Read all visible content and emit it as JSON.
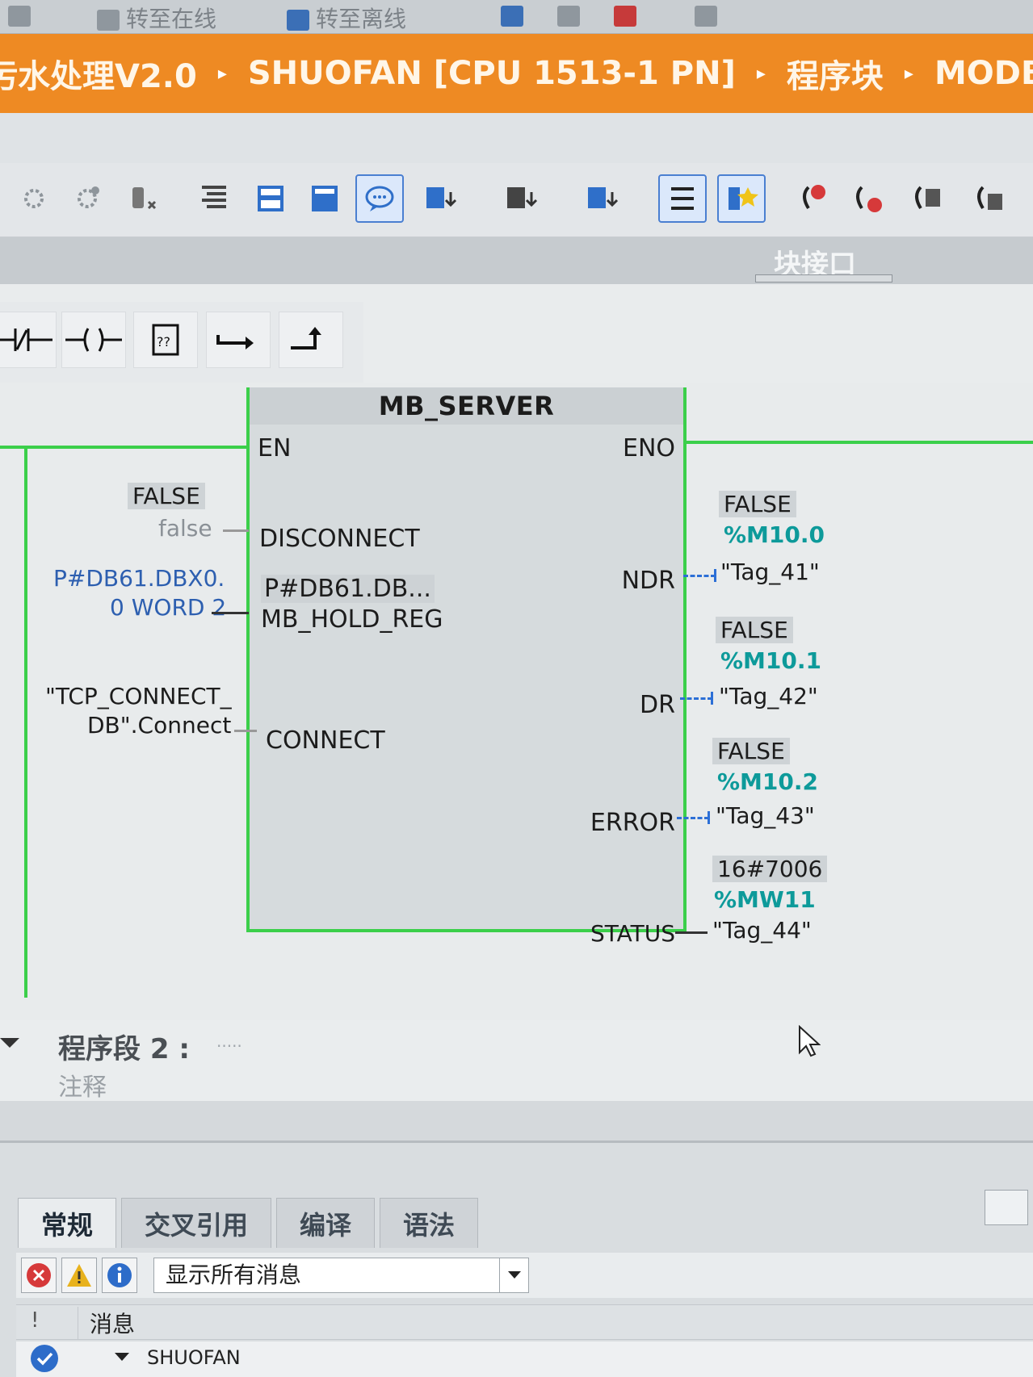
{
  "top_strip": {
    "item1": "转至在线",
    "item2": "转至离线"
  },
  "breadcrumb": {
    "items": [
      "污水处理V2.0",
      "SHUOFAN [CPU 1513-1 PN]",
      "程序块",
      "MODBUS"
    ],
    "separator": "▸",
    "color": "#ee8a23"
  },
  "toolbar": {
    "icons": [
      "compile-icon",
      "compile-all-icon",
      "download-icon",
      "indent-icon",
      "insert-network-icon",
      "delete-network-icon",
      "comment-icon",
      "input-icon",
      "output-icon",
      "inout-icon",
      "list-icon",
      "favorites-icon",
      "go-to-error-icon",
      "go-to-warning-icon",
      "monitor-icon",
      "monitor-all-icon"
    ]
  },
  "block_interface": {
    "label": "块接口"
  },
  "lad_bar": {
    "icons": [
      "nc-contact-icon",
      "coil-icon",
      "empty-box-icon",
      "open-branch-icon",
      "close-branch-icon"
    ]
  },
  "block": {
    "title": "MB_SERVER",
    "pins": {
      "en": "EN",
      "eno": "ENO",
      "disconnect": "DISCONNECT",
      "mb_hold_reg_value": "P#DB61.DB...",
      "mb_hold_reg": "MB_HOLD_REG",
      "connect": "CONNECT",
      "ndr": "NDR",
      "dr": "DR",
      "error": "ERROR",
      "status": "STATUS"
    },
    "inputs": {
      "disconnect_monitor": "FALSE",
      "disconnect_actual": "false",
      "mb_hold_reg_line1": "P#DB61.DBX0.",
      "mb_hold_reg_line2": "0 WORD 2",
      "connect_line1": "\"TCP_CONNECT_",
      "connect_line2": "DB\".Connect"
    },
    "outputs": {
      "ndr_monitor": "FALSE",
      "ndr_address": "%M10.0",
      "ndr_tag": "\"Tag_41\"",
      "dr_monitor": "FALSE",
      "dr_address": "%M10.1",
      "dr_tag": "\"Tag_42\"",
      "error_monitor": "FALSE",
      "error_address": "%M10.2",
      "error_tag": "\"Tag_43\"",
      "status_monitor": "16#7006",
      "status_address": "%MW11",
      "status_tag": "\"Tag_44\""
    }
  },
  "segment2": {
    "title": "程序段 2 :",
    "dots": ".....",
    "comment": "注释"
  },
  "inspector": {
    "tabs": [
      "常规",
      "交叉引用",
      "编译",
      "语法"
    ],
    "filter_value": "显示所有消息",
    "column_bang": "!",
    "column_message": "消息",
    "row_project": "SHUOFAN"
  },
  "colors": {
    "rail_green": "#3bcf4a",
    "teal_address": "#0d9a9a",
    "link_blue": "#2c6fd6"
  }
}
